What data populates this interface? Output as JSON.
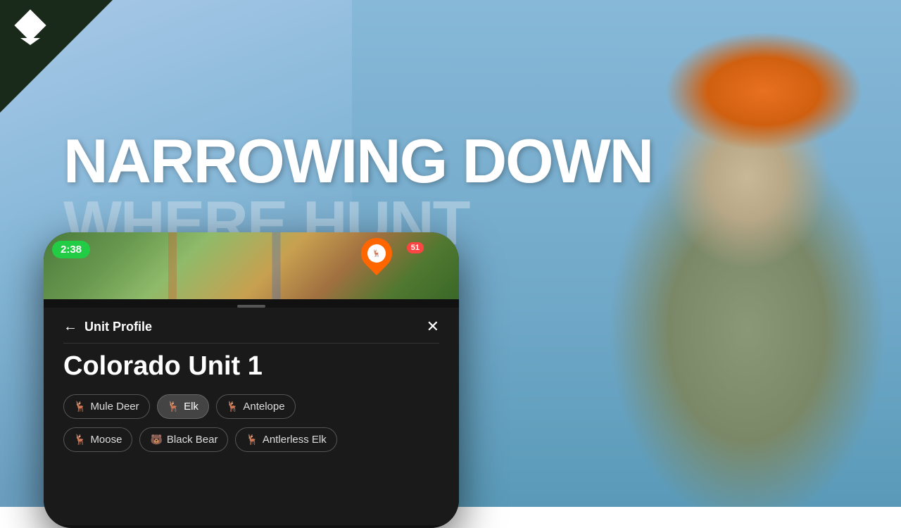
{
  "background": {
    "color_start": "#a8c8e8",
    "color_end": "#5a8aaa"
  },
  "logo": {
    "alt": "onX Hunt Logo"
  },
  "heading": {
    "line1": "NARROWING DOWN",
    "line2": "WHERE HUNT"
  },
  "phone": {
    "map": {
      "timer": "2:38",
      "count_badge": "51"
    },
    "nav": {
      "back_label": "←",
      "title": "Unit Profile",
      "close_label": "✕"
    },
    "unit_title": "Colorado Unit 1",
    "species_rows": [
      [
        {
          "label": "Mule Deer",
          "icon": "🦌",
          "active": false
        },
        {
          "label": "Elk",
          "icon": "🦌",
          "active": true
        },
        {
          "label": "Antelope",
          "icon": "🦌",
          "active": false
        }
      ],
      [
        {
          "label": "Moose",
          "icon": "🦌",
          "active": false
        },
        {
          "label": "Black Bear",
          "icon": "🐻",
          "active": false
        },
        {
          "label": "Antlerless Elk",
          "icon": "🦌",
          "active": false
        }
      ]
    ]
  }
}
